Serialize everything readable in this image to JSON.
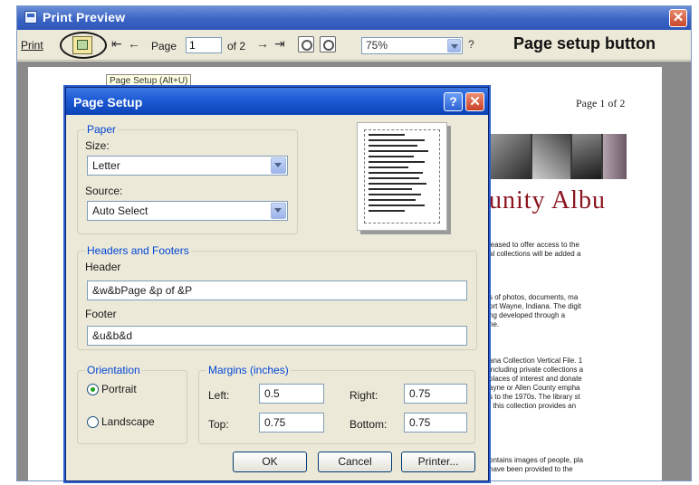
{
  "window": {
    "title": "Print Preview",
    "close_glyph": "✕"
  },
  "toolbar": {
    "print_label": "Print",
    "setup_tooltip": "Page Setup (Alt+U)",
    "page_label": "Page",
    "page_value": "1",
    "of_label": "of 2",
    "zoom_value": "75%",
    "help_label": "?",
    "annotation": "Page setup button",
    "first_glyph": "⇤",
    "prev_glyph": "←",
    "next_glyph": "→",
    "last_glyph": "⇥"
  },
  "preview_page": {
    "page_indicator": "Page 1 of 2",
    "banner_text": "unity Albu",
    "paragraphs": [
      [
        "leased to offer access to the",
        "al collections will be added a"
      ],
      [
        "s of photos, documents, ma",
        "ort Wayne, Indiana. The digit",
        "ng developed through a",
        "ne."
      ],
      [
        "ana Collection Vertical File. 1",
        "including private collections a",
        "places of interest and donate",
        "ayne or Allen County empha",
        "s to the 1970s. The library st",
        ". this collection provides an"
      ],
      [
        "ontains images of people, pla",
        "have been provided to the"
      ]
    ]
  },
  "dialog": {
    "title": "Page Setup",
    "help_glyph": "?",
    "close_glyph": "✕",
    "paper": {
      "legend": "Paper",
      "size_label": "Size:",
      "size_value": "Letter",
      "source_label": "Source:",
      "source_value": "Auto Select"
    },
    "headers_footers": {
      "legend": "Headers and Footers",
      "header_label": "Header",
      "header_value": "&w&bPage &p of &P",
      "footer_label": "Footer",
      "footer_value": "&u&b&d"
    },
    "orientation": {
      "legend": "Orientation",
      "portrait_label": "Portrait",
      "landscape_label": "Landscape",
      "selected": "Portrait"
    },
    "margins": {
      "legend": "Margins (inches)",
      "left_label": "Left:",
      "left_value": "0.5",
      "right_label": "Right:",
      "right_value": "0.75",
      "top_label": "Top:",
      "top_value": "0.75",
      "bottom_label": "Bottom:",
      "bottom_value": "0.75"
    },
    "buttons": {
      "ok": "OK",
      "cancel": "Cancel",
      "printer": "Printer..."
    }
  },
  "colors": {
    "titlebar": "#2d56b8",
    "legend_text": "#0046d5",
    "banner_text": "#8b1520"
  },
  "icons": [
    "app-icon",
    "page-setup-icon",
    "zoom-in-icon",
    "zoom-out-icon",
    "close-icon",
    "help-icon"
  ]
}
